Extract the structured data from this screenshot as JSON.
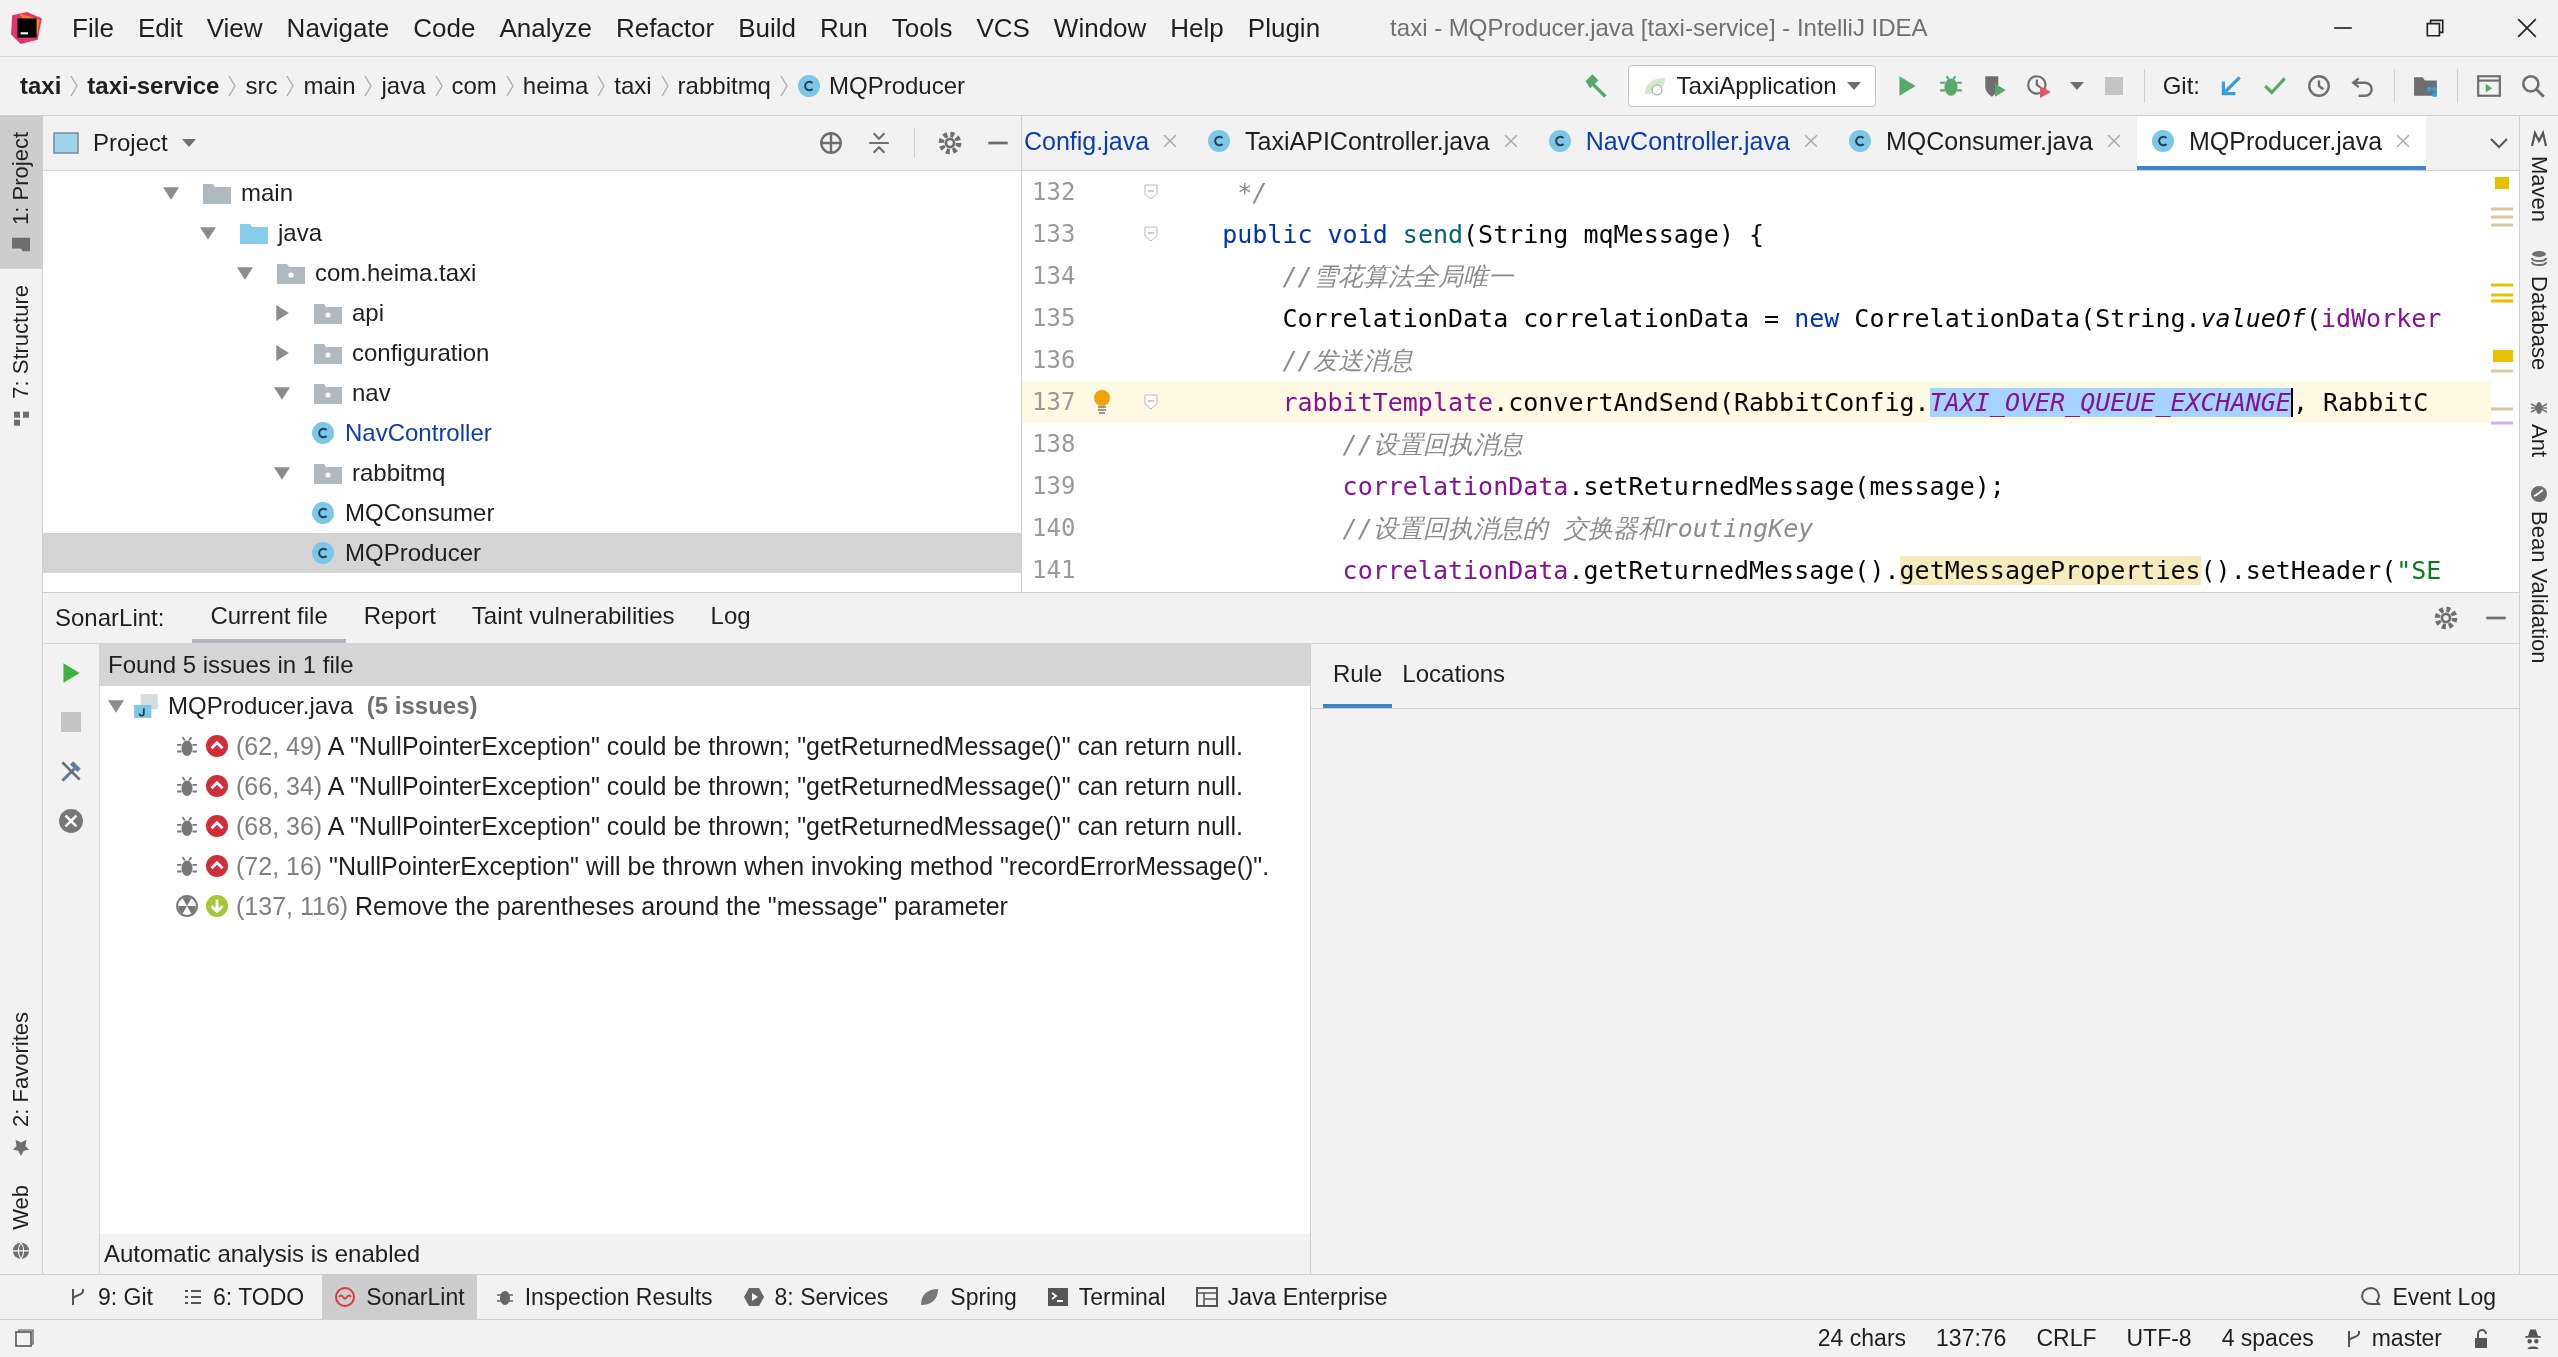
{
  "window": {
    "title": "taxi - MQProducer.java [taxi-service] - IntelliJ IDEA"
  },
  "menu": [
    "File",
    "Edit",
    "View",
    "Navigate",
    "Code",
    "Analyze",
    "Refactor",
    "Build",
    "Run",
    "Tools",
    "VCS",
    "Window",
    "Help",
    "Plugin"
  ],
  "breadcrumbs": [
    {
      "label": "taxi",
      "kind": "module"
    },
    {
      "label": "taxi-service",
      "kind": "module"
    },
    {
      "label": "src",
      "kind": "folder"
    },
    {
      "label": "main",
      "kind": "folder"
    },
    {
      "label": "java",
      "kind": "folder"
    },
    {
      "label": "com",
      "kind": "folder"
    },
    {
      "label": "heima",
      "kind": "folder"
    },
    {
      "label": "taxi",
      "kind": "folder"
    },
    {
      "label": "rabbitmq",
      "kind": "folder"
    },
    {
      "label": "MQProducer",
      "kind": "class"
    }
  ],
  "toolbar": {
    "run_config": "TaxiApplication",
    "vcs_label": "Git:"
  },
  "left_tool_windows": {
    "top": [
      {
        "label": "1: Project",
        "kind": "project",
        "selected": true
      },
      {
        "label": "7: Structure",
        "kind": "structure",
        "selected": false
      }
    ],
    "bottom": [
      {
        "label": "2: Favorites",
        "kind": "favorites",
        "selected": false
      },
      {
        "label": "Web",
        "kind": "web",
        "selected": false
      }
    ]
  },
  "right_tool_windows": [
    {
      "label": "Maven",
      "kind": "maven"
    },
    {
      "label": "Database",
      "kind": "database"
    },
    {
      "label": "Ant",
      "kind": "ant"
    },
    {
      "label": "Bean Validation",
      "kind": "bean"
    }
  ],
  "project_panel": {
    "title": "Project",
    "tree": [
      {
        "label": "main",
        "kind": "folder",
        "expanded": true,
        "selected": false,
        "modified": false,
        "children": [
          {
            "label": "java",
            "kind": "source-folder",
            "expanded": true,
            "selected": false,
            "modified": false,
            "children": [
              {
                "label": "com.heima.taxi",
                "kind": "package",
                "expanded": true,
                "selected": false,
                "modified": false,
                "children": [
                  {
                    "label": "api",
                    "kind": "package",
                    "expanded": false,
                    "selected": false,
                    "modified": false
                  },
                  {
                    "label": "configuration",
                    "kind": "package",
                    "expanded": false,
                    "selected": false,
                    "modified": false
                  },
                  {
                    "label": "nav",
                    "kind": "package",
                    "expanded": true,
                    "selected": false,
                    "modified": false,
                    "children": [
                      {
                        "label": "NavController",
                        "kind": "class",
                        "selected": false,
                        "modified": true
                      }
                    ]
                  },
                  {
                    "label": "rabbitmq",
                    "kind": "package",
                    "expanded": true,
                    "selected": false,
                    "modified": false,
                    "children": [
                      {
                        "label": "MQConsumer",
                        "kind": "class",
                        "selected": false,
                        "modified": false
                      },
                      {
                        "label": "MQProducer",
                        "kind": "class",
                        "selected": true,
                        "modified": false
                      }
                    ]
                  }
                ]
              }
            ]
          }
        ]
      }
    ]
  },
  "editor": {
    "tabs": [
      {
        "label": "Config.java",
        "selected": false,
        "modified": true,
        "class_icon": false
      },
      {
        "label": "TaxiAPIController.java",
        "selected": false,
        "modified": false,
        "class_icon": true
      },
      {
        "label": "NavController.java",
        "selected": false,
        "modified": true,
        "class_icon": true
      },
      {
        "label": "MQConsumer.java",
        "selected": false,
        "modified": false,
        "class_icon": true
      },
      {
        "label": "MQProducer.java",
        "selected": true,
        "modified": false,
        "class_icon": true
      }
    ],
    "lines": [
      {
        "number": "132",
        "current": false,
        "fold": true,
        "intention": false,
        "tokens": [
          {
            "kind": "doc",
            "text": "     */"
          }
        ]
      },
      {
        "number": "133",
        "current": false,
        "fold": true,
        "intention": false,
        "tokens": [
          {
            "kind": "keyword",
            "text": "    public void "
          },
          {
            "kind": "decl",
            "text": "send"
          },
          {
            "kind": "plain",
            "text": "(String mqMessage) {"
          }
        ]
      },
      {
        "number": "134",
        "current": false,
        "fold": false,
        "intention": false,
        "tokens": [
          {
            "kind": "comment",
            "text": "        //雪花算法全局唯一"
          }
        ]
      },
      {
        "number": "135",
        "current": false,
        "fold": false,
        "intention": false,
        "tokens": [
          {
            "kind": "plain",
            "text": "        CorrelationData correlationData = "
          },
          {
            "kind": "keyword",
            "text": "new"
          },
          {
            "kind": "plain",
            "text": " CorrelationData(String."
          },
          {
            "kind": "static",
            "text": "valueOf"
          },
          {
            "kind": "plain",
            "text": "("
          },
          {
            "kind": "field",
            "text": "idWorker"
          }
        ]
      },
      {
        "number": "136",
        "current": false,
        "fold": false,
        "intention": false,
        "tokens": [
          {
            "kind": "comment",
            "text": "        //发送消息"
          }
        ]
      },
      {
        "number": "137",
        "current": true,
        "fold": true,
        "intention": true,
        "tokens": [
          {
            "kind": "field",
            "text": "        rabbitTemplate"
          },
          {
            "kind": "plain",
            "text": ".convertAndSend(RabbitConfig."
          },
          {
            "kind": "selection",
            "text": "TAXI_OVER_QUEUE_EXCHANGE"
          },
          {
            "kind": "plain",
            "text": ", RabbitC"
          }
        ]
      },
      {
        "number": "138",
        "current": false,
        "fold": false,
        "intention": false,
        "tokens": [
          {
            "kind": "comment",
            "text": "            //设置回执消息"
          }
        ]
      },
      {
        "number": "139",
        "current": false,
        "fold": false,
        "intention": false,
        "tokens": [
          {
            "kind": "field",
            "text": "            correlationData"
          },
          {
            "kind": "plain",
            "text": ".setReturnedMessage(message);"
          }
        ]
      },
      {
        "number": "140",
        "current": false,
        "fold": false,
        "intention": false,
        "tokens": [
          {
            "kind": "comment",
            "text": "            //设置回执消息的 交换器和routingKey"
          }
        ]
      },
      {
        "number": "141",
        "current": false,
        "fold": false,
        "intention": false,
        "tokens": [
          {
            "kind": "field",
            "text": "            correlationData"
          },
          {
            "kind": "plain",
            "text": ".getReturnedMessage()."
          },
          {
            "kind": "usage",
            "text": "getMessageProperties"
          },
          {
            "kind": "plain",
            "text": "().setHeader("
          },
          {
            "kind": "string",
            "text": "\"SE"
          }
        ]
      }
    ]
  },
  "sonarlint": {
    "title": "SonarLint:",
    "tabs": [
      {
        "label": "Current file",
        "selected": true
      },
      {
        "label": "Report",
        "selected": false
      },
      {
        "label": "Taint vulnerabilities",
        "selected": false
      },
      {
        "label": "Log",
        "selected": false
      }
    ],
    "summary": "Found 5 issues in 1 file",
    "file": {
      "name": "MQProducer.java",
      "count": "(5 issues)",
      "expanded": true,
      "issues": [
        {
          "kind": "critical-bug",
          "location": "(62, 49)",
          "message": "A \"NullPointerException\" could be thrown; \"getReturnedMessage()\" can return null."
        },
        {
          "kind": "critical-bug",
          "location": "(66, 34)",
          "message": "A \"NullPointerException\" could be thrown; \"getReturnedMessage()\" can return null."
        },
        {
          "kind": "critical-bug",
          "location": "(68, 36)",
          "message": "A \"NullPointerException\" could be thrown; \"getReturnedMessage()\" can return null."
        },
        {
          "kind": "critical-bug",
          "location": "(72, 16)",
          "message": "\"NullPointerException\" will be thrown when invoking method \"recordErrorMessage()\"."
        },
        {
          "kind": "minor-code-smell",
          "location": "(137, 116)",
          "message": "Remove the parentheses around the \"message\" parameter"
        }
      ]
    },
    "footer": "Automatic analysis is enabled",
    "detail_tabs": [
      {
        "label": "Rule",
        "selected": true
      },
      {
        "label": "Locations",
        "selected": false
      }
    ]
  },
  "bottom_tool_windows": {
    "left": [
      {
        "label": "9: Git",
        "kind": "git",
        "selected": false
      },
      {
        "label": "6: TODO",
        "kind": "todo",
        "selected": false
      },
      {
        "label": "SonarLint",
        "kind": "sonarlint",
        "selected": true
      },
      {
        "label": "Inspection Results",
        "kind": "inspection",
        "selected": false
      },
      {
        "label": "8: Services",
        "kind": "services",
        "selected": false
      },
      {
        "label": "Spring",
        "kind": "spring",
        "selected": false
      },
      {
        "label": "Terminal",
        "kind": "terminal",
        "selected": false
      },
      {
        "label": "Java Enterprise",
        "kind": "javaee",
        "selected": false
      }
    ],
    "right": [
      {
        "label": "Event Log",
        "kind": "eventlog",
        "selected": false
      }
    ]
  },
  "status_bar": {
    "items": [
      "24 chars",
      "137:76",
      "CRLF",
      "UTF-8",
      "4 spaces"
    ],
    "branch": "master"
  }
}
